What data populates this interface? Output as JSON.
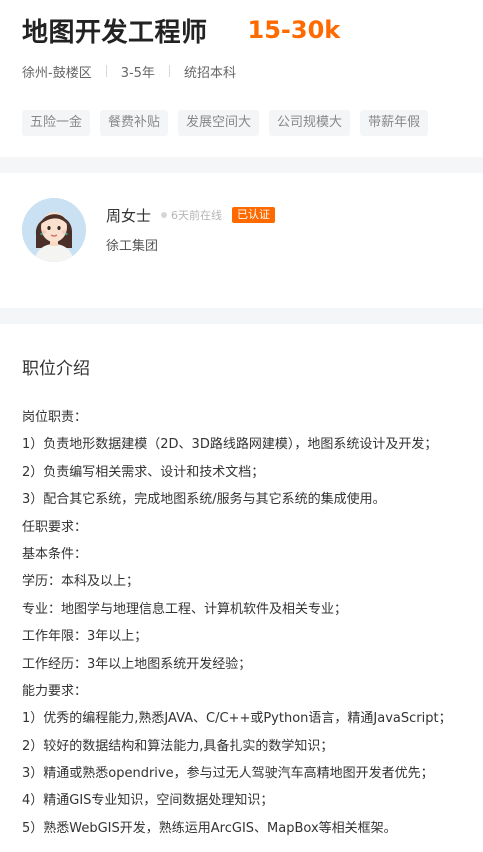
{
  "job": {
    "title": "地图开发工程师",
    "salary": "15-30k",
    "location": "徐州-鼓楼区",
    "experience": "3-5年",
    "education": "统招本科",
    "tags": [
      "五险一金",
      "餐费补贴",
      "发展空间大",
      "公司规模大",
      "带薪年假"
    ]
  },
  "recruiter": {
    "name": "周女士",
    "online_status": "6天前在线",
    "badge": "已认证",
    "company": "徐工集团",
    "avatar_icon": "female-avatar-icon"
  },
  "description": {
    "title": "职位介绍",
    "lines": [
      "岗位职责：",
      "1）负责地形数据建模（2D、3D路线路网建模），地图系统设计及开发；",
      "2）负责编写相关需求、设计和技术文档；",
      "3）配合其它系统，完成地图系统/服务与其它系统的集成使用。",
      "任职要求：",
      "基本条件：",
      "学历：本科及以上；",
      "专业：地图学与地理信息工程、计算机软件及相关专业；",
      "工作年限：3年以上；",
      "工作经历：3年以上地图系统开发经验；",
      "能力要求：",
      "1）优秀的编程能力,熟悉JAVA、C/C++或Python语言，精通JavaScript；",
      "2）较好的数据结构和算法能力,具备扎实的数学知识；",
      "3）精通或熟悉opendrive，参与过无人驾驶汽车高精地图开发者优先；",
      "4）精通GIS专业知识，空间数据处理知识；",
      "5）熟悉WebGIS开发，熟练运用ArcGIS、MapBox等相关框架。"
    ]
  },
  "colors": {
    "accent": "#ff6a00",
    "tag_bg": "#f4f5f7",
    "section_gap": "#f5f6f8"
  }
}
